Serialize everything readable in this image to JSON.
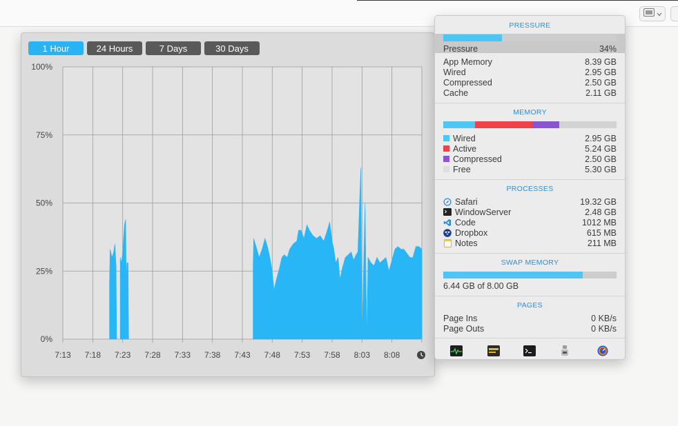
{
  "history": {
    "tabs": [
      {
        "label": "1 Hour",
        "active": true
      },
      {
        "label": "24 Hours",
        "active": false
      },
      {
        "label": "7 Days",
        "active": false
      },
      {
        "label": "30 Days",
        "active": false
      }
    ]
  },
  "chart_data": {
    "type": "area",
    "title": "",
    "xlabel": "",
    "ylabel": "",
    "grid": true,
    "ylim": [
      0,
      100
    ],
    "y_ticks": [
      "100%",
      "75%",
      "50%",
      "25%",
      "0%"
    ],
    "x_ticks": [
      "7:13",
      "7:18",
      "7:23",
      "7:28",
      "7:33",
      "7:38",
      "7:43",
      "7:48",
      "7:53",
      "7:58",
      "8:03",
      "8:08"
    ],
    "x_range_minutes": [
      0,
      60
    ],
    "color": "#29b6f6",
    "series": [
      {
        "values": [
          [
            7.8,
            20
          ],
          [
            7.9,
            33
          ],
          [
            8.2,
            30
          ],
          [
            8.5,
            32
          ],
          [
            8.7,
            35
          ],
          [
            8.9,
            27
          ],
          [
            9.0,
            0
          ]
        ]
      },
      {
        "values": [
          [
            9.6,
            30
          ],
          [
            9.8,
            28
          ],
          [
            10.0,
            32
          ],
          [
            10.3,
            42
          ],
          [
            10.5,
            44
          ],
          [
            10.6,
            20
          ],
          [
            10.7,
            28
          ],
          [
            10.9,
            28
          ],
          [
            11.0,
            0
          ]
        ]
      },
      {
        "values": [
          [
            31.8,
            27
          ],
          [
            31.9,
            37
          ],
          [
            32.3,
            34
          ],
          [
            32.8,
            30
          ],
          [
            33.3,
            33
          ],
          [
            33.8,
            37
          ],
          [
            34.2,
            34
          ],
          [
            34.6,
            30
          ],
          [
            35.0,
            25
          ],
          [
            35.3,
            18
          ],
          [
            35.7,
            22
          ],
          [
            36.2,
            26
          ],
          [
            36.6,
            30
          ],
          [
            37.0,
            31
          ],
          [
            37.5,
            30
          ],
          [
            37.9,
            33
          ],
          [
            38.5,
            35
          ],
          [
            39.1,
            36
          ],
          [
            39.4,
            40
          ],
          [
            39.8,
            40
          ],
          [
            40.3,
            37
          ],
          [
            40.8,
            42
          ],
          [
            41.2,
            40
          ],
          [
            41.8,
            38
          ],
          [
            42.4,
            37
          ],
          [
            43.0,
            38
          ],
          [
            43.6,
            36
          ],
          [
            44.2,
            40
          ],
          [
            44.6,
            43
          ],
          [
            45.0,
            36
          ],
          [
            45.3,
            33
          ],
          [
            45.6,
            28
          ],
          [
            46.0,
            30
          ],
          [
            46.3,
            22
          ],
          [
            46.7,
            26
          ],
          [
            47.2,
            30
          ],
          [
            47.7,
            31
          ],
          [
            48.2,
            32
          ],
          [
            48.6,
            29
          ],
          [
            49.0,
            31
          ],
          [
            49.3,
            32
          ],
          [
            49.8,
            63
          ],
          [
            50.0,
            0
          ],
          [
            50.5,
            50
          ],
          [
            50.8,
            0
          ],
          [
            51.0,
            30
          ],
          [
            51.5,
            28
          ],
          [
            52.0,
            27
          ],
          [
            52.5,
            30
          ],
          [
            53.0,
            28
          ],
          [
            53.5,
            29
          ],
          [
            54.0,
            30
          ],
          [
            54.5,
            25
          ],
          [
            55.0,
            29
          ],
          [
            55.5,
            33
          ],
          [
            56.0,
            34
          ],
          [
            56.5,
            33
          ],
          [
            57.0,
            33
          ],
          [
            58.0,
            30
          ],
          [
            58.5,
            30
          ],
          [
            59.0,
            34
          ],
          [
            59.5,
            34
          ],
          [
            60.0,
            33
          ]
        ]
      }
    ]
  },
  "panel": {
    "pressure": {
      "title": "PRESSURE",
      "bar_fraction": 0.34,
      "label": "Pressure",
      "value": "34%",
      "rows": [
        {
          "label": "App Memory",
          "value": "8.39 GB"
        },
        {
          "label": "Wired",
          "value": "2.95 GB"
        },
        {
          "label": "Compressed",
          "value": "2.50 GB"
        },
        {
          "label": "Cache",
          "value": "2.11 GB"
        }
      ]
    },
    "memory": {
      "title": "MEMORY",
      "segments": [
        {
          "label": "Wired",
          "value": "2.95 GB",
          "gb": 2.95,
          "color": "#4dc6f5"
        },
        {
          "label": "Active",
          "value": "5.24 GB",
          "gb": 5.24,
          "color": "#f0424a"
        },
        {
          "label": "Compressed",
          "value": "2.50 GB",
          "gb": 2.5,
          "color": "#8a55d1"
        },
        {
          "label": "Free",
          "value": "5.30 GB",
          "gb": 5.3,
          "color": "#d3d3d3"
        }
      ]
    },
    "processes": {
      "title": "PROCESSES",
      "items": [
        {
          "name": "Safari",
          "value": "19.32 GB",
          "icon": "safari-icon"
        },
        {
          "name": "WindowServer",
          "value": "2.48 GB",
          "icon": "terminal-icon"
        },
        {
          "name": "Code",
          "value": "1012 MB",
          "icon": "vscode-icon"
        },
        {
          "name": "Dropbox",
          "value": "615 MB",
          "icon": "dropbox-icon"
        },
        {
          "name": "Notes",
          "value": "211 MB",
          "icon": "notes-icon"
        }
      ]
    },
    "swap": {
      "title": "SWAP MEMORY",
      "fraction": 0.805,
      "text": "6.44 GB of 8.00 GB"
    },
    "pages": {
      "title": "PAGES",
      "rows": [
        {
          "label": "Page Ins",
          "value": "0 KB/s"
        },
        {
          "label": "Page Outs",
          "value": "0 KB/s"
        }
      ]
    },
    "footer_icons": [
      "activity-monitor-icon",
      "console-icon",
      "terminal-icon",
      "system-info-icon",
      "istat-menus-icon"
    ]
  }
}
